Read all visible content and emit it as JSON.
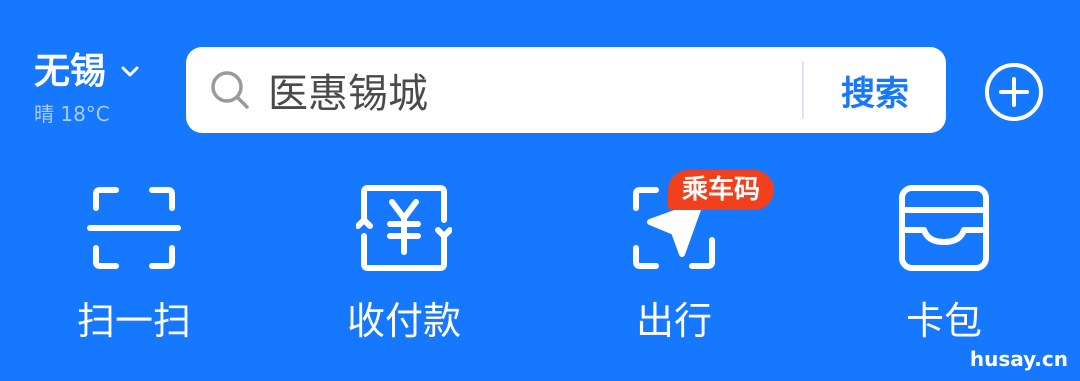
{
  "header": {
    "city": "无锡",
    "weather": "晴 18°C",
    "search_placeholder": "医惠锡城",
    "search_button": "搜索"
  },
  "quick_actions": [
    {
      "label": "扫一扫",
      "icon": "scan-icon"
    },
    {
      "label": "收付款",
      "icon": "payment-icon"
    },
    {
      "label": "出行",
      "icon": "travel-icon",
      "badge": "乘车码"
    },
    {
      "label": "卡包",
      "icon": "wallet-icon"
    }
  ],
  "watermark": "husay.cn",
  "colors": {
    "background": "#1677ff",
    "badge": "#f0401e"
  }
}
